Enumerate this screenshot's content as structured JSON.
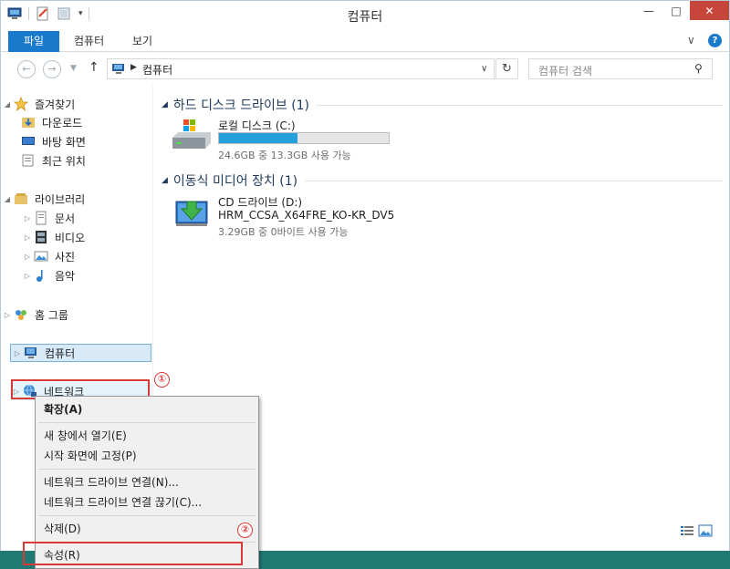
{
  "window": {
    "title": "컴퓨터",
    "controls": {
      "minimize": "—",
      "maximize": "□",
      "close": "✕"
    }
  },
  "ribbon": {
    "tabs": [
      "파일",
      "컴퓨터",
      "보기"
    ],
    "expand_chevron": "∨",
    "help": "?"
  },
  "navigation": {
    "back": "←",
    "forward": "→",
    "up": "↑",
    "address_sep": "▶",
    "address_path": "컴퓨터",
    "refresh": "↻",
    "search_placeholder": "컴퓨터 검색"
  },
  "sidebar": {
    "favorites": {
      "label": "즐겨찾기",
      "items": [
        "다운로드",
        "바탕 화면",
        "최근 위치"
      ]
    },
    "libraries": {
      "label": "라이브러리",
      "items": [
        "문서",
        "비디오",
        "사진",
        "음악"
      ]
    },
    "homegroup": "홈 그룹",
    "computer": "컴퓨터",
    "network": "네트워크"
  },
  "content": {
    "hdd_group": "하드 디스크 드라이브 (1)",
    "local_disk": {
      "name": "로컬 디스크 (C:)",
      "free": "24.6GB 중 13.3GB 사용 가능",
      "used_fraction": 0.46
    },
    "removable_group": "이동식 미디어 장치 (1)",
    "cd_drive": {
      "name": "CD 드라이브 (D:)",
      "label": "HRM_CCSA_X64FRE_KO-KR_DV5",
      "free": "3.29GB 중 0바이트 사용 가능"
    }
  },
  "context_menu": {
    "expand": "확장(A)",
    "open_new_window": "새 창에서 열기(E)",
    "pin_start": "시작 화면에 고정(P)",
    "map_drive": "네트워크 드라이브 연결(N)...",
    "disconnect_drive": "네트워크 드라이브 연결 끊기(C)...",
    "delete": "삭제(D)",
    "properties": "속성(R)"
  },
  "annotations": {
    "marker1": "①",
    "marker2": "②"
  },
  "colors": {
    "accent": "#1979ca",
    "highlight": "#d83a3a",
    "progress": "#26a0da",
    "desktop": "#1f7a74"
  }
}
